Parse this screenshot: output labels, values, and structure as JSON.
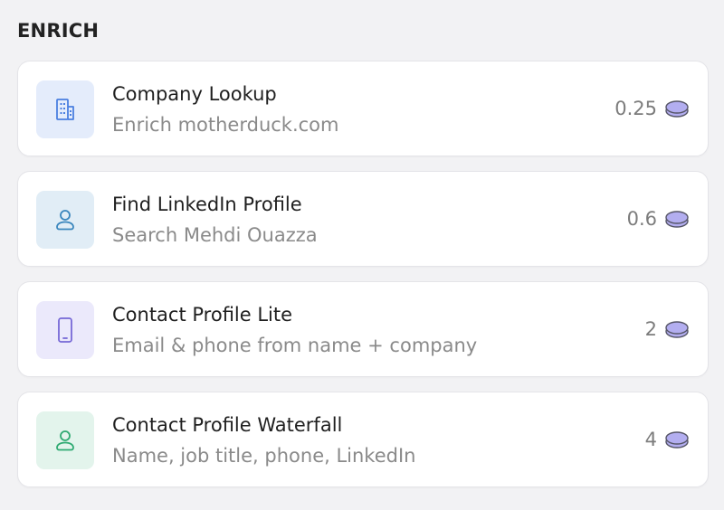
{
  "section": {
    "title": "ENRICH"
  },
  "colors": {
    "coin_fill": "#b3aef0",
    "coin_stroke": "#555566"
  },
  "items": [
    {
      "title": "Company Lookup",
      "subtitle": "Enrich motherduck.com",
      "cost": "0.25",
      "icon": "building-icon",
      "icon_bg": "#e4ecfb",
      "icon_color": "#4a7fe0"
    },
    {
      "title": "Find LinkedIn Profile",
      "subtitle": "Search Mehdi Ouazza",
      "cost": "0.6",
      "icon": "user-icon",
      "icon_bg": "#e1edf6",
      "icon_color": "#3a86bd"
    },
    {
      "title": "Contact Profile Lite",
      "subtitle": "Email & phone from name + company",
      "cost": "2",
      "icon": "smartphone-icon",
      "icon_bg": "#ebe9fb",
      "icon_color": "#7668d6"
    },
    {
      "title": "Contact Profile Waterfall",
      "subtitle": "Name, job title, phone, LinkedIn",
      "cost": "4",
      "icon": "user-icon",
      "icon_bg": "#e3f4ec",
      "icon_color": "#2faa72"
    }
  ]
}
